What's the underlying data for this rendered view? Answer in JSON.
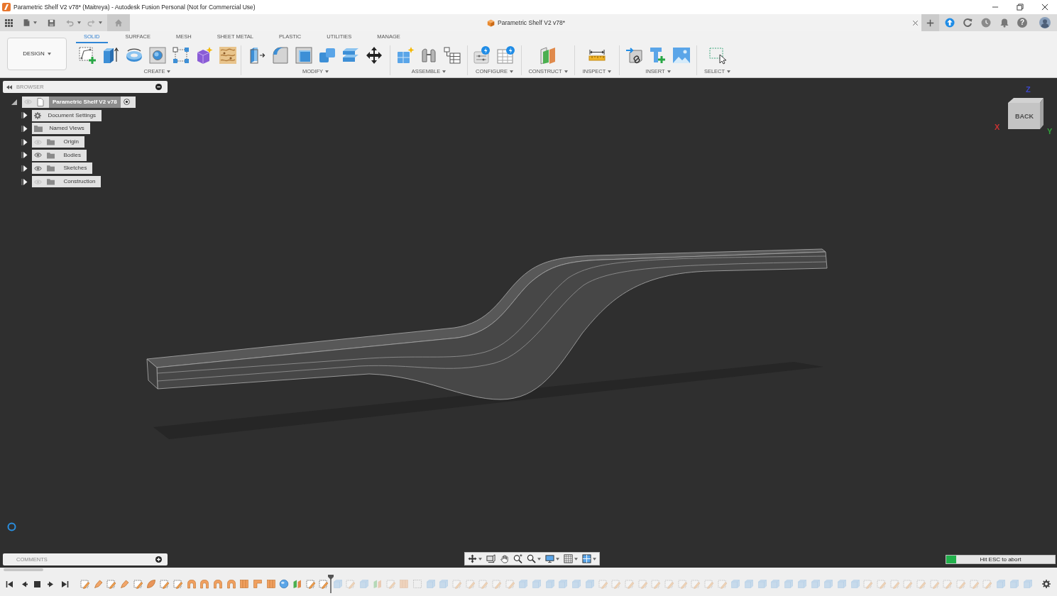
{
  "window": {
    "title": "Parametric Shelf V2 v78* (Maitreya) - Autodesk Fusion Personal (Not for Commercial Use)"
  },
  "document_tab": {
    "title": "Parametric Shelf V2 v78*"
  },
  "help_button": {
    "label": "?"
  },
  "workspace_menu": {
    "label": "DESIGN"
  },
  "tabs": [
    {
      "label": "SOLID",
      "selected": true
    },
    {
      "label": "SURFACE",
      "selected": false
    },
    {
      "label": "MESH",
      "selected": false
    },
    {
      "label": "SHEET METAL",
      "selected": false
    },
    {
      "label": "PLASTIC",
      "selected": false
    },
    {
      "label": "UTILITIES",
      "selected": false
    },
    {
      "label": "MANAGE",
      "selected": false
    }
  ],
  "tool_groups": [
    {
      "kind": "create",
      "label": "CREATE"
    },
    {
      "kind": "modify",
      "label": "MODIFY"
    },
    {
      "kind": "assemble",
      "label": "ASSEMBLE"
    },
    {
      "kind": "configure",
      "label": "CONFIGURE"
    },
    {
      "kind": "construct",
      "label": "CONSTRUCT"
    },
    {
      "kind": "inspect",
      "label": "INSPECT"
    },
    {
      "kind": "insert",
      "label": "INSERT"
    },
    {
      "kind": "select",
      "label": "SELECT"
    }
  ],
  "browser": {
    "title": "BROWSER",
    "tree": [
      {
        "kind": "document",
        "label": "Parametric Shelf V2 v78",
        "visible": false,
        "expanded": true,
        "selected": true,
        "children": [
          {
            "kind": "settings",
            "label": "Document Settings",
            "expanded": false,
            "selected": false
          },
          {
            "kind": "views",
            "label": "Named Views",
            "expanded": false,
            "selected": false
          },
          {
            "kind": "folder",
            "label": "Origin",
            "visible": false,
            "expanded": false,
            "selected": false
          },
          {
            "kind": "folder",
            "label": "Bodies",
            "visible": true,
            "expanded": false,
            "selected": false
          },
          {
            "kind": "folder",
            "label": "Sketches",
            "visible": true,
            "expanded": false,
            "selected": false
          },
          {
            "kind": "folder",
            "label": "Construction",
            "visible": false,
            "expanded": false,
            "selected": false
          }
        ]
      }
    ]
  },
  "view_cube": {
    "face_label": "BACK",
    "axes": [
      {
        "label": "Z",
        "color": "#3c46c8"
      },
      {
        "label": "X",
        "color": "#c83232"
      },
      {
        "label": "Y",
        "color": "#32a03c"
      }
    ]
  },
  "comments": {
    "title": "COMMENTS"
  },
  "progress": {
    "label": "Hit ESC to abort",
    "level": 0.09
  },
  "timeline": {
    "features": [
      {
        "kind": "sketch",
        "active": true
      },
      {
        "kind": "form",
        "active": true
      },
      {
        "kind": "sketch",
        "active": true
      },
      {
        "kind": "form",
        "active": true
      },
      {
        "kind": "sketch",
        "active": true
      },
      {
        "kind": "patch",
        "active": true
      },
      {
        "kind": "sketch",
        "active": true
      },
      {
        "kind": "sketch",
        "active": true
      },
      {
        "kind": "fillet",
        "active": true
      },
      {
        "kind": "fillet",
        "active": true
      },
      {
        "kind": "fillet",
        "active": true
      },
      {
        "kind": "fillet",
        "active": true
      },
      {
        "kind": "box",
        "active": true
      },
      {
        "kind": "corner",
        "active": true
      },
      {
        "kind": "box",
        "active": true
      },
      {
        "kind": "sphere",
        "active": true
      },
      {
        "kind": "plane",
        "active": true
      },
      {
        "kind": "sketch",
        "active": true
      },
      {
        "kind": "sketch",
        "active": true
      },
      {
        "kind": "surface",
        "active": false
      },
      {
        "kind": "sketch",
        "active": false
      },
      {
        "kind": "surface",
        "active": false
      },
      {
        "kind": "plane",
        "active": false
      },
      {
        "kind": "sketch",
        "active": false
      },
      {
        "kind": "box",
        "active": false
      },
      {
        "kind": "select",
        "active": false
      },
      {
        "kind": "surface",
        "active": false
      },
      {
        "kind": "surface",
        "active": false
      },
      {
        "kind": "sketch",
        "active": false
      },
      {
        "kind": "sketch",
        "active": false
      },
      {
        "kind": "sketch",
        "active": false
      },
      {
        "kind": "sketch",
        "active": false
      },
      {
        "kind": "sketch",
        "active": false
      },
      {
        "kind": "surface",
        "active": false
      },
      {
        "kind": "surface",
        "active": false
      },
      {
        "kind": "surface",
        "active": false
      },
      {
        "kind": "surface",
        "active": false
      },
      {
        "kind": "surface",
        "active": false
      },
      {
        "kind": "surface",
        "active": false
      },
      {
        "kind": "sketch",
        "active": false
      },
      {
        "kind": "sketch",
        "active": false
      },
      {
        "kind": "sketch",
        "active": false
      },
      {
        "kind": "sketch",
        "active": false
      },
      {
        "kind": "sketch",
        "active": false
      },
      {
        "kind": "sketch",
        "active": false
      },
      {
        "kind": "sketch",
        "active": false
      },
      {
        "kind": "sketch",
        "active": false
      },
      {
        "kind": "sketch",
        "active": false
      },
      {
        "kind": "sketch",
        "active": false
      },
      {
        "kind": "surface",
        "active": false
      },
      {
        "kind": "surface",
        "active": false
      },
      {
        "kind": "surface",
        "active": false
      },
      {
        "kind": "surface",
        "active": false
      },
      {
        "kind": "surface",
        "active": false
      },
      {
        "kind": "surface",
        "active": false
      },
      {
        "kind": "surface",
        "active": false
      },
      {
        "kind": "surface",
        "active": false
      },
      {
        "kind": "surface",
        "active": false
      },
      {
        "kind": "surface",
        "active": false
      },
      {
        "kind": "sketch",
        "active": false
      },
      {
        "kind": "sketch",
        "active": false
      },
      {
        "kind": "sketch",
        "active": false
      },
      {
        "kind": "sketch",
        "active": false
      },
      {
        "kind": "sketch",
        "active": false
      },
      {
        "kind": "sketch",
        "active": false
      },
      {
        "kind": "sketch",
        "active": false
      },
      {
        "kind": "sketch",
        "active": false
      },
      {
        "kind": "sketch",
        "active": false
      },
      {
        "kind": "sketch",
        "active": false
      },
      {
        "kind": "surface",
        "active": false
      },
      {
        "kind": "surface",
        "active": false
      },
      {
        "kind": "surface",
        "active": false
      }
    ]
  }
}
